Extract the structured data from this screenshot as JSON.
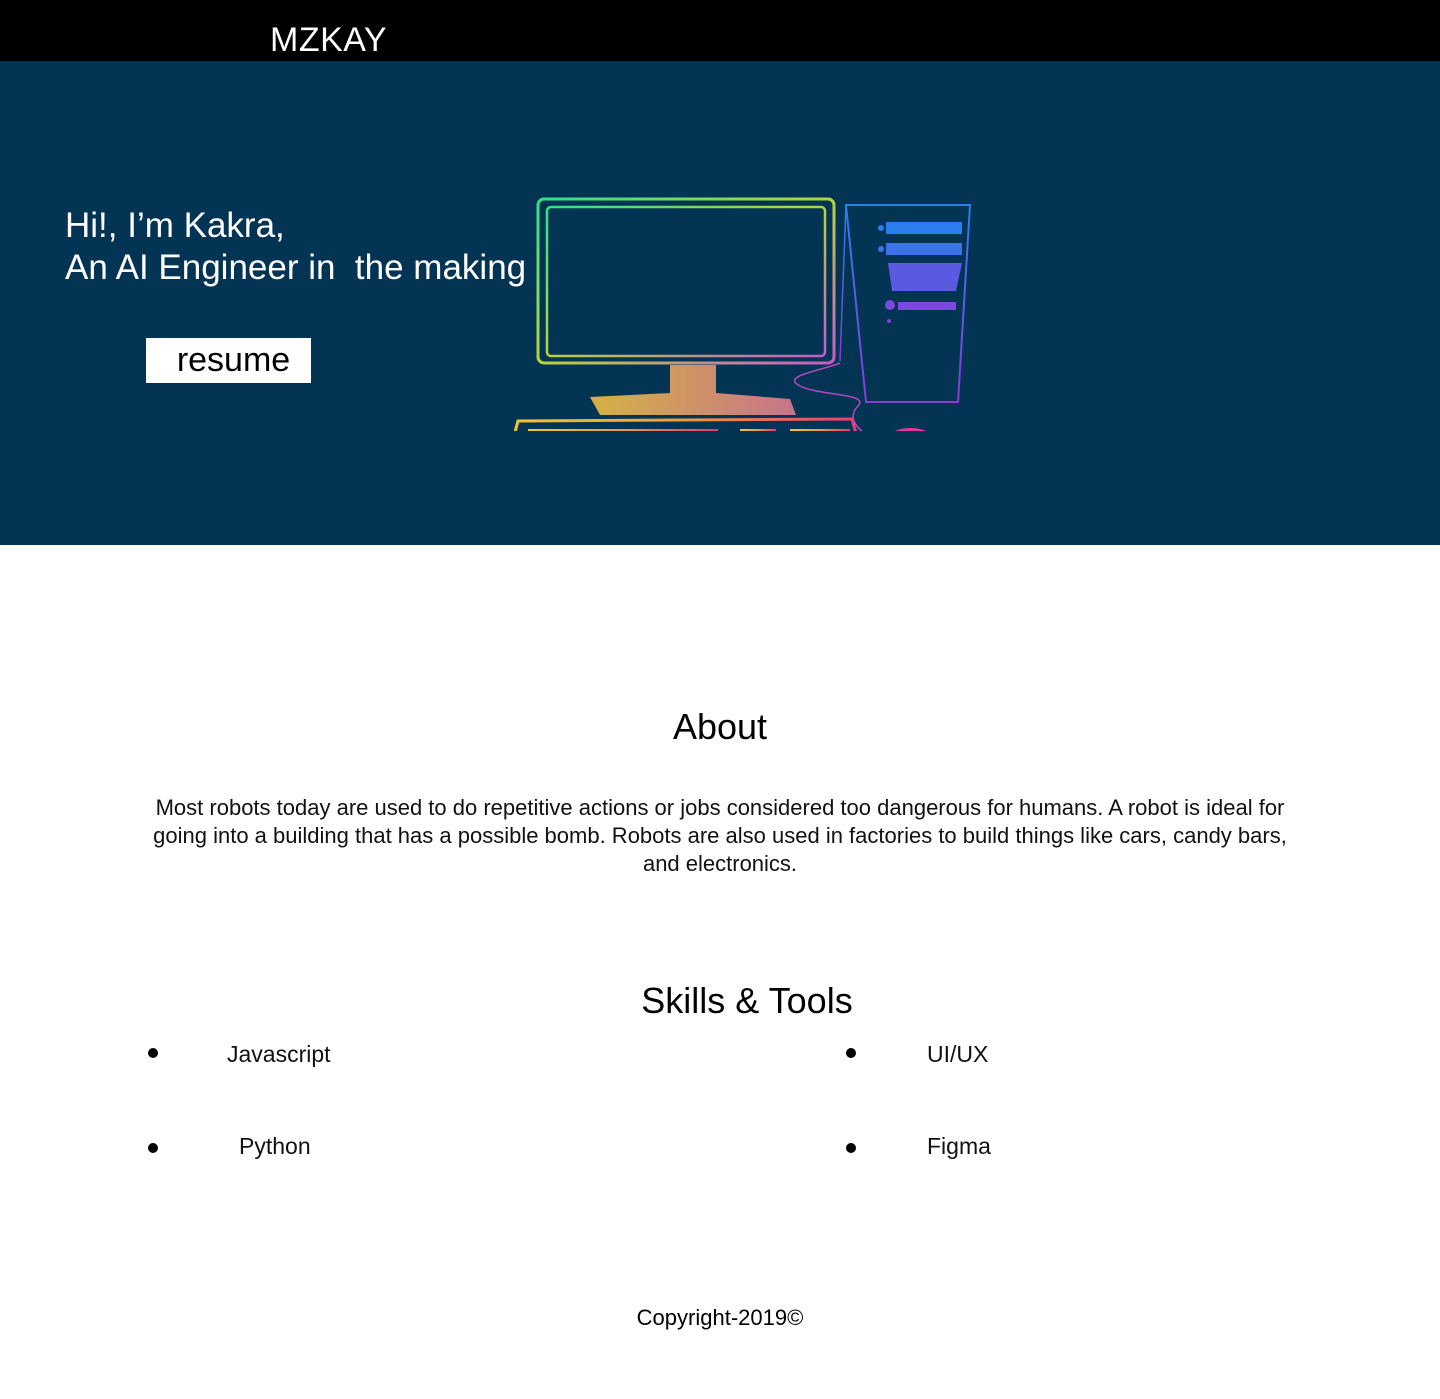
{
  "header": {
    "logo": "MZKAY"
  },
  "hero": {
    "greeting": "Hi!, I’m Kakra,",
    "tagline": "An AI Engineer in  the making",
    "resume_label": "resume",
    "illustration_icon": "desktop-computer-icon"
  },
  "about": {
    "title": "About",
    "text": "Most robots today are used to do repetitive actions or jobs considered too dangerous for humans. A robot is ideal for going into a building that has a possible bomb. Robots are also used in factories to build things like cars, candy bars, and electronics."
  },
  "skills": {
    "title": "Skills & Tools",
    "items": [
      "Javascript",
      "UI/UX",
      "Python",
      "Figma"
    ]
  },
  "footer": {
    "copyright": "Copyright-2019©"
  },
  "colors": {
    "topbar": "#000000",
    "hero_background": "#043454",
    "hero_text": "#ffffff"
  }
}
